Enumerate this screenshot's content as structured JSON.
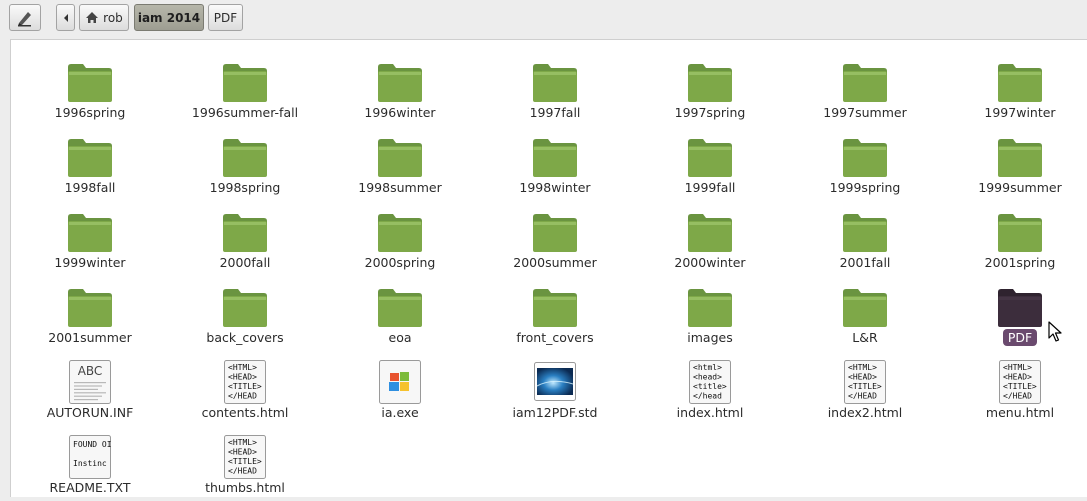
{
  "toolbar": {
    "edit_icon": "pencil-icon",
    "back_icon": "left-arrow-icon",
    "home_icon": "home-icon",
    "breadcrumbs": [
      "rob",
      "iam 2014",
      "PDF"
    ],
    "active_crumb": "iam 2014"
  },
  "colors": {
    "folder_green": "#7ea848",
    "folder_selected": "#3c2d3c",
    "selection_label": "#6a4a6e"
  },
  "items": [
    {
      "label": "1996spring",
      "kind": "folder"
    },
    {
      "label": "1996summer-fall",
      "kind": "folder"
    },
    {
      "label": "1996winter",
      "kind": "folder"
    },
    {
      "label": "1997fall",
      "kind": "folder"
    },
    {
      "label": "1997spring",
      "kind": "folder"
    },
    {
      "label": "1997summer",
      "kind": "folder"
    },
    {
      "label": "1997winter",
      "kind": "folder"
    },
    {
      "label": "1998fall",
      "kind": "folder"
    },
    {
      "label": "1998spring",
      "kind": "folder"
    },
    {
      "label": "1998summer",
      "kind": "folder"
    },
    {
      "label": "1998winter",
      "kind": "folder"
    },
    {
      "label": "1999fall",
      "kind": "folder"
    },
    {
      "label": "1999spring",
      "kind": "folder"
    },
    {
      "label": "1999summer",
      "kind": "folder"
    },
    {
      "label": "1999winter",
      "kind": "folder"
    },
    {
      "label": "2000fall",
      "kind": "folder"
    },
    {
      "label": "2000spring",
      "kind": "folder"
    },
    {
      "label": "2000summer",
      "kind": "folder"
    },
    {
      "label": "2000winter",
      "kind": "folder"
    },
    {
      "label": "2001fall",
      "kind": "folder"
    },
    {
      "label": "2001spring",
      "kind": "folder"
    },
    {
      "label": "2001summer",
      "kind": "folder"
    },
    {
      "label": "back_covers",
      "kind": "folder"
    },
    {
      "label": "eoa",
      "kind": "folder"
    },
    {
      "label": "front_covers",
      "kind": "folder"
    },
    {
      "label": "images",
      "kind": "folder"
    },
    {
      "label": "L&R",
      "kind": "folder"
    },
    {
      "label": "PDF",
      "kind": "folder",
      "selected": true
    },
    {
      "label": "AUTORUN.INF",
      "kind": "text",
      "preview": "ABC"
    },
    {
      "label": "contents.html",
      "kind": "html",
      "preview": [
        "<HTML>",
        "<HEAD>",
        "<TITLE>",
        "</HEAD"
      ]
    },
    {
      "label": "ia.exe",
      "kind": "exe"
    },
    {
      "label": "iam12PDF.std",
      "kind": "image"
    },
    {
      "label": "index.html",
      "kind": "html",
      "preview": [
        "<html>",
        "<head>",
        "<title>",
        "</head"
      ]
    },
    {
      "label": "index2.html",
      "kind": "html",
      "preview": [
        "<HTML>",
        "<HEAD>",
        "<TITLE>",
        "</HEAD"
      ]
    },
    {
      "label": "menu.html",
      "kind": "html",
      "preview": [
        "<HTML>",
        "<HEAD>",
        "<TITLE>",
        "</HEAD"
      ]
    },
    {
      "label": "README.TXT",
      "kind": "readme",
      "preview": [
        "FOUND OI",
        "Instinc"
      ]
    },
    {
      "label": "thumbs.html",
      "kind": "html",
      "preview": [
        "<HTML>",
        "<HEAD>",
        "<TITLE>",
        "</HEAD"
      ]
    }
  ]
}
